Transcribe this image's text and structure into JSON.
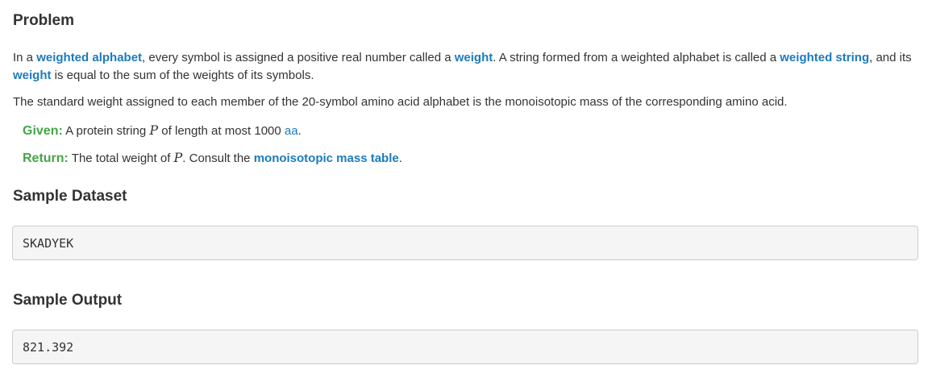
{
  "problem": {
    "heading": "Problem",
    "p1": {
      "t1": "In a ",
      "link_weighted_alphabet": "weighted alphabet",
      "t2": ", every symbol is assigned a positive real number called a ",
      "link_weight": "weight",
      "t3": ". A string formed from a weighted alphabet is called a ",
      "link_weighted_string": "weighted string",
      "t4": ", and its ",
      "link_weight2": "weight",
      "t5": " is equal to the sum of the weights of its symbols."
    },
    "p2": "The standard weight assigned to each member of the 20-symbol amino acid alphabet is the monoisotopic mass of the corresponding amino acid.",
    "given": {
      "label": "Given:",
      "t1": " A protein string ",
      "var": "P",
      "t2": " of length at most 1000 ",
      "link_aa": "aa",
      "t3": "."
    },
    "return": {
      "label": "Return:",
      "t1": " The total weight of ",
      "var": "P",
      "t2": ". Consult the ",
      "link_table": "monoisotopic mass table",
      "t3": "."
    }
  },
  "sample_dataset": {
    "heading": "Sample Dataset",
    "value": "SKADYEK"
  },
  "sample_output": {
    "heading": "Sample Output",
    "value": "821.392"
  },
  "colors": {
    "link": "#1c7bbd",
    "label_green": "#46a546",
    "text": "#333333",
    "code_bg": "#f5f5f5"
  }
}
